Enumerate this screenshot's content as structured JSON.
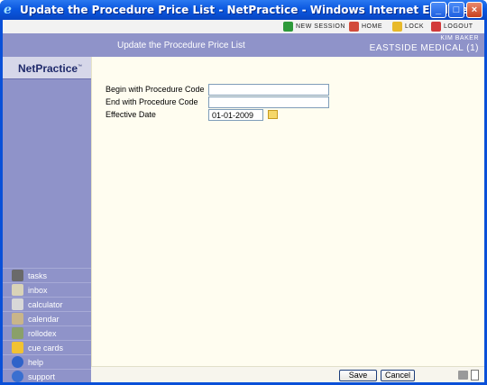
{
  "window": {
    "title": "Update the Procedure Price List - NetPractice - Windows Internet Explorer",
    "buttons": {
      "minimize": "_",
      "maximize": "□",
      "close": "×"
    }
  },
  "toolbar": {
    "new_session": "NEW SESSION",
    "home": "HOME",
    "lock": "LOCK",
    "logout": "LOGOUT"
  },
  "header": {
    "page_title": "Update the Procedure Price List",
    "user": "KIM BAKER",
    "organization": "EASTSIDE MEDICAL (1)"
  },
  "logo": {
    "name": "NetPractice",
    "tm": "™"
  },
  "nav": [
    {
      "label": "tasks",
      "icon": "tasks-icon",
      "color": "#6a6a6a"
    },
    {
      "label": "inbox",
      "icon": "inbox-icon",
      "color": "#d9d3b8"
    },
    {
      "label": "calculator",
      "icon": "calculator-icon",
      "color": "#d8d8d8"
    },
    {
      "label": "calendar",
      "icon": "calendar-icon",
      "color": "#c9b58a"
    },
    {
      "label": "rollodex",
      "icon": "rolodex-icon",
      "color": "#8aa06a"
    },
    {
      "label": "cue cards",
      "icon": "cue-cards-icon",
      "color": "#f1c232"
    },
    {
      "label": "help",
      "icon": "help-icon",
      "color": "#2f63c9"
    },
    {
      "label": "support",
      "icon": "support-icon",
      "color": "#3a6fd0"
    }
  ],
  "form": {
    "begin_label": "Begin with Procedure Code",
    "begin_value": "",
    "end_label": "End with Procedure Code",
    "end_value": "",
    "date_label": "Effective Date",
    "date_value": "01-01-2009"
  },
  "footer": {
    "save": "Save",
    "cancel": "Cancel"
  },
  "colors": {
    "accent": "#8f93c9",
    "window": "#0a50d8",
    "content": "#fffdf0"
  }
}
